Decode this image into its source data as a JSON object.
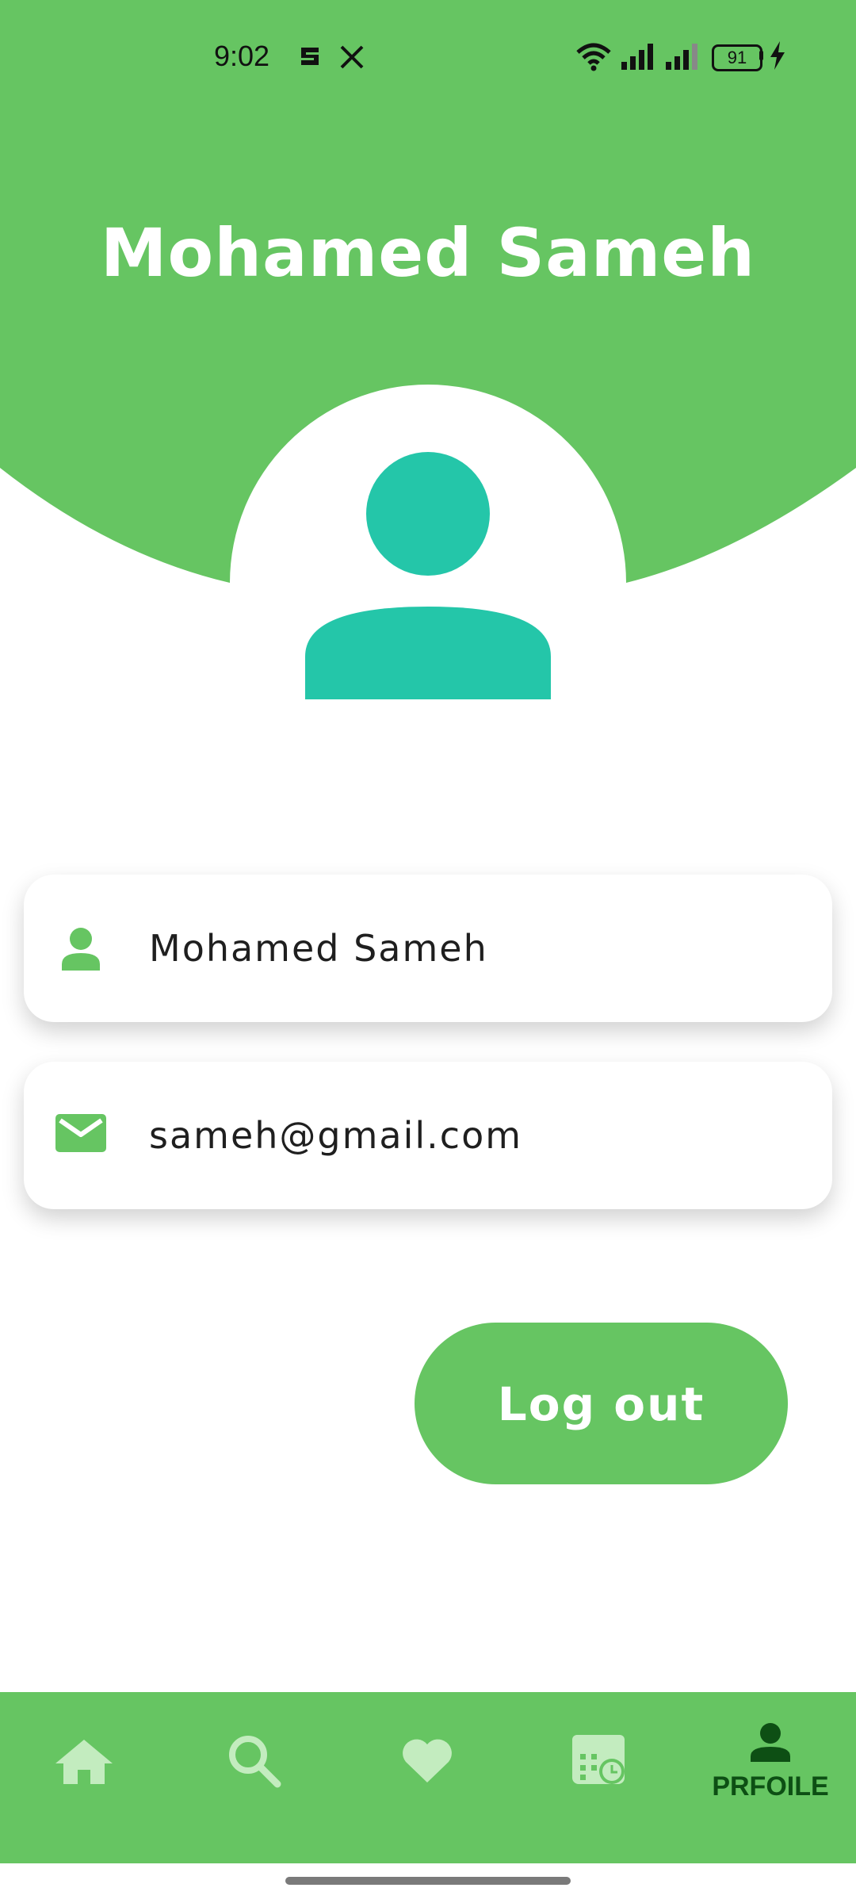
{
  "status_bar": {
    "time": "9:02",
    "battery": "91"
  },
  "header": {
    "title": "Mohamed Sameh"
  },
  "profile": {
    "name": "Mohamed Sameh",
    "email": "sameh@gmail.com"
  },
  "actions": {
    "logout_label": "Log out"
  },
  "bottom_nav": {
    "items": [
      {
        "icon": "home-icon",
        "active": false
      },
      {
        "icon": "search-icon",
        "active": false
      },
      {
        "icon": "heart-icon",
        "active": false
      },
      {
        "icon": "calendar-icon",
        "active": false
      },
      {
        "icon": "person-icon",
        "active": true,
        "label": "PRFOILE"
      }
    ]
  },
  "colors": {
    "primary_green": "#66c562",
    "avatar_teal": "#24c6a9",
    "nav_inactive": "#c3ecbf",
    "nav_active": "#0d4f14"
  }
}
